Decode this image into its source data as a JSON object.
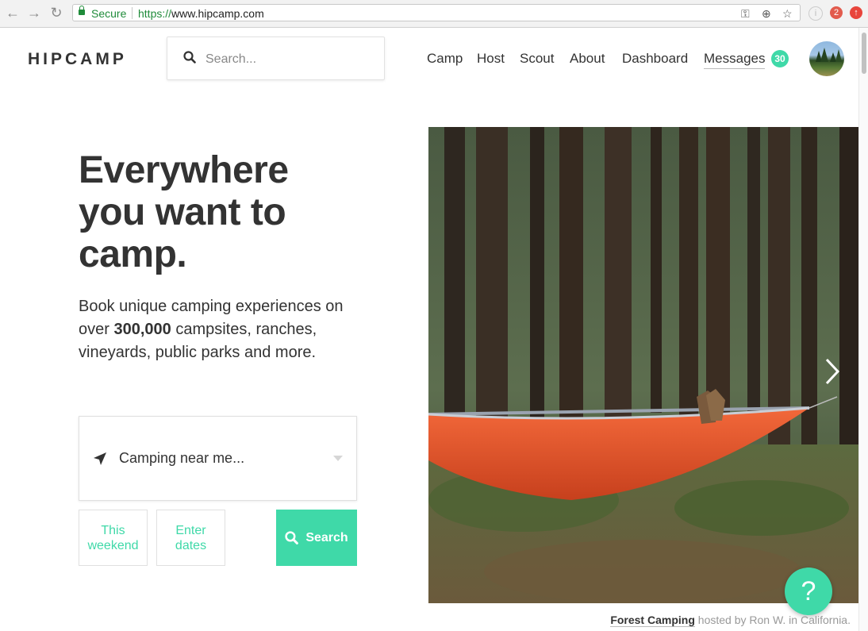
{
  "browser": {
    "secure_label": "Secure",
    "url_scheme": "https://",
    "url_host": "www.hipcamp.com",
    "extension_badge": "2"
  },
  "header": {
    "logo": "HIPCAMP",
    "search_placeholder": "Search...",
    "nav": {
      "camp": "Camp",
      "host": "Host",
      "scout": "Scout",
      "about": "About",
      "dashboard": "Dashboard",
      "messages": "Messages"
    },
    "messages_count": "30"
  },
  "hero": {
    "headline_lines": [
      "Everywhere",
      "you want to",
      "camp."
    ],
    "sub_before": "Book unique camping experiences on over ",
    "sub_bold": "300,000",
    "sub_after": " campsites, ranches, vineyards, public parks and more.",
    "location_placeholder": "Camping near me...",
    "date_this_weekend": [
      "This",
      "weekend"
    ],
    "date_enter": [
      "Enter",
      "dates"
    ],
    "search_label": "Search"
  },
  "photo": {
    "caption_title": "Forest Camping",
    "caption_rest": " hosted by Ron W. in California."
  },
  "help_label": "?",
  "colors": {
    "accent": "#3fd9a8",
    "text": "#333333",
    "secure_green": "#1f8b3a",
    "hammock": "#e8552b"
  },
  "icons": {
    "back": "arrow-left-icon",
    "forward": "arrow-right-icon",
    "reload": "reload-icon",
    "search": "search-icon",
    "location": "location-arrow-icon",
    "next": "chevron-right-icon",
    "help": "help-icon"
  }
}
